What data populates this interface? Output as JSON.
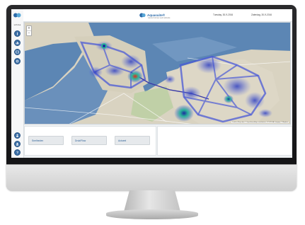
{
  "app": {
    "brand_name": "Aquasuite®",
    "brand_sub": "wanter.beheer.optimalisatie",
    "date_left": "Tuesday, 30-9-2016",
    "date_right": "Zaterdag, 30-9-2016"
  },
  "sidebar": {
    "status_text": "sdf dsa",
    "top_buttons": [
      "info-icon",
      "chart-icon",
      "map-icon",
      "settings-icon"
    ],
    "bottom_buttons": [
      "user-icon",
      "profile-icon",
      "help-icon"
    ]
  },
  "map": {
    "zoom_in": "+",
    "zoom_out": "−",
    "attribution": "Leaflet | Map data © OpenStreetMap contributors, CC-BY-SA, Imagery © Mapbox"
  },
  "panel": {
    "buttons": [
      "Snelheden",
      "Druk/Flow",
      "Actueel"
    ]
  },
  "colors": {
    "accent": "#2b6aa8",
    "water": "#5c86b4",
    "land": "#d9d3c1",
    "heat_blue": "#3e52c8",
    "heat_hot": "#e23b2f",
    "heat_green": "#2cb59a"
  }
}
